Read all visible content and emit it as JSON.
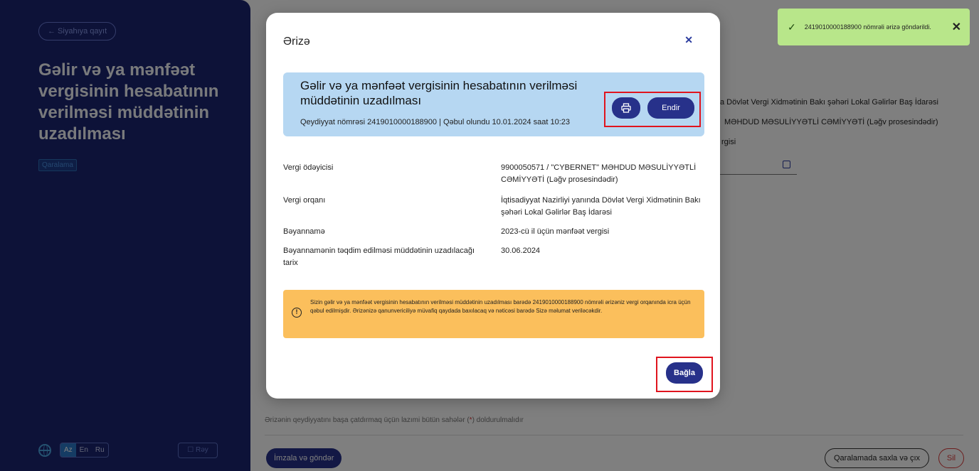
{
  "sidebar": {
    "back_label": "← Siyahıya qayıt",
    "title": "Gəlir və ya mənfəət vergisinin hesabatının verilməsi müddətinin uzadılması",
    "status_badge": "Qaralama",
    "languages": [
      "Az",
      "En",
      "Ru"
    ],
    "active_language": "Az",
    "opinion_label": "☐ Rəy"
  },
  "background_page": {
    "line1": "a Dövlət Vergi Xidmətinin Bakı şəhəri Lokal Gəlirlər Baş İdarəsi",
    "line2": "MƏHDUD MƏSULİYYƏTLİ CƏMİYYƏTİ (Ləğv prosesindədir)",
    "line3": "rgisi",
    "required_note_before": "Ərizənin qeydiyyatını başa çatdırmaq üçün lazımi bütün sahələr (",
    "required_note_star": "*",
    "required_note_after": ") doldurulmalıdır",
    "sign_button": "İmzala və göndər",
    "save_draft_button": "Qaralamada saxla və çıx",
    "delete_button": "Sil"
  },
  "toast": {
    "message": "2419010000188900 nömrəli ərizə göndərildi.",
    "color": "#b8e68a"
  },
  "modal": {
    "title": "Ərizə",
    "header": {
      "application_name": "Gəlir və ya mənfəət vergisinin hesabatının verilməsi müddətinin uzadılması",
      "meta": "Qeydiyyat nömrəsi 2419010000188900 | Qəbul olundu 10.01.2024 saat 10:23"
    },
    "download_button": "Endir",
    "fields": [
      {
        "label": "Vergi ödəyicisi",
        "value": "9900050571 / \"CYBERNET\" MƏHDUD MƏSULİYYƏTLİ CƏMİYYƏTİ (Ləğv prosesindədir)"
      },
      {
        "label": "Vergi orqanı",
        "value": "İqtisadiyyat Nazirliyi yanında Dövlət Vergi Xidmətinin Bakı şəhəri Lokal Gəlirlər Baş İdarəsi"
      },
      {
        "label": "Bəyannamə",
        "value": "2023-cü il üçün mənfəət vergisi"
      },
      {
        "label": "Bəyannamənin təqdim edilməsi müddətinin uzadılacağı tarix",
        "value": "30.06.2024"
      }
    ],
    "warning": "Sizin gəlir və ya mənfəət vergisinin hesabatının verilməsi müddətinin uzadılması barədə 2419010000188900 nömrəli ərizəniz vergi orqanında icra üçün qəbul edilmişdir. Ərizənizə qanunvericiliyə müvafiq qaydada baxılacaq və nəticəsi barədə Sizə məlumat veriləcəkdir.",
    "close_button": "Bağla"
  }
}
